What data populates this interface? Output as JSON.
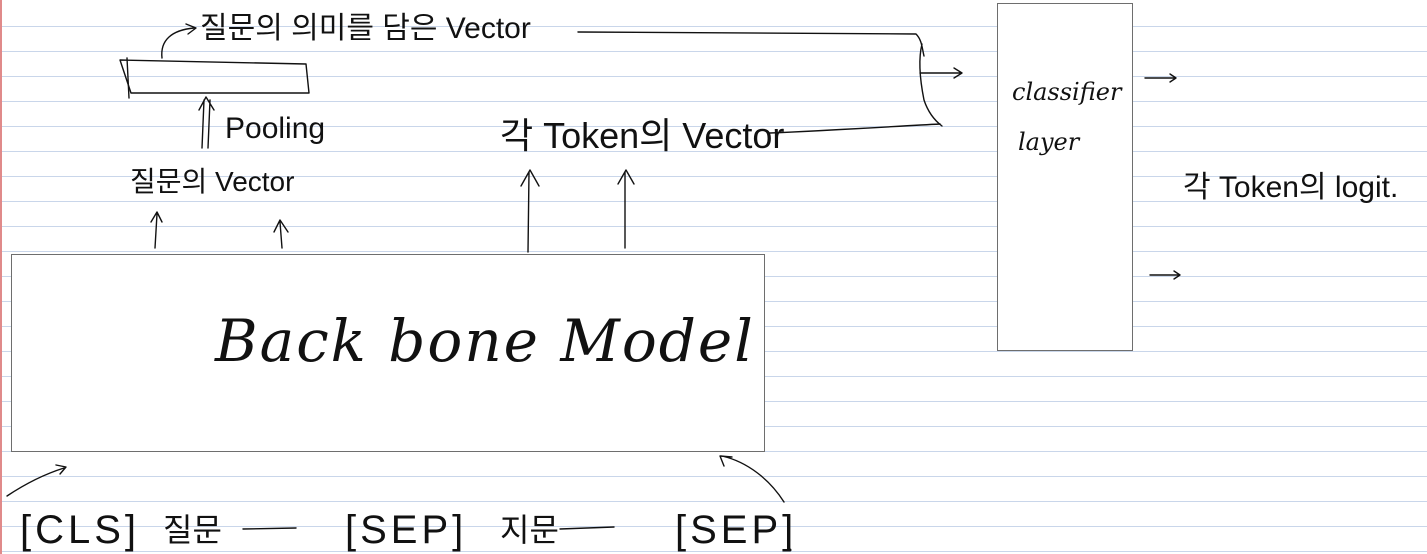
{
  "diagram": {
    "backbone": {
      "label": "Back bone Model"
    },
    "classifier": {
      "label_line1": "classifier",
      "label_line2": "layer"
    },
    "annotations": {
      "meaning_vector": "질문의 의미를 담은 Vector",
      "pooling": "Pooling",
      "question_vector": "질문의 Vector",
      "token_vector": "각 Token의 Vector",
      "token_logit": "각 Token의 logit."
    },
    "input_sequence": [
      "[CLS]",
      "질문",
      "[SEP]",
      "지문",
      "[SEP]"
    ]
  }
}
